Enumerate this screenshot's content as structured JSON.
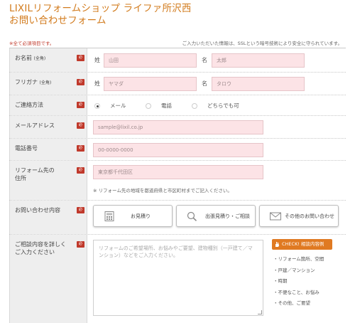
{
  "header": {
    "title_line1": "LIXILリフォームショップ ライファ所沢西",
    "title_line2": "お問い合わせフォーム",
    "required_note": "※全て必須項目です。",
    "privacy_note": "ご入力いただいた情報は、SSLという暗号技術により安全に守られています。"
  },
  "required_badge": "必",
  "rows": {
    "name": {
      "label": "お名前",
      "label_sub": "(全角)",
      "sei_prefix": "姓",
      "sei_placeholder": "山田",
      "mei_prefix": "名",
      "mei_placeholder": "太郎"
    },
    "furigana": {
      "label": "フリガナ",
      "label_sub": "(全角)",
      "sei_prefix": "姓",
      "sei_placeholder": "ヤマダ",
      "mei_prefix": "名",
      "mei_placeholder": "タロウ"
    },
    "contact_method": {
      "label": "ご連絡方法",
      "options": [
        "メール",
        "電話",
        "どちらでも可"
      ],
      "selected": "メール"
    },
    "email": {
      "label": "メールアドレス",
      "placeholder": "sample@lixil.co.jp"
    },
    "phone": {
      "label": "電話番号",
      "placeholder": "00-0000-0000"
    },
    "address": {
      "label_line1": "リフォーム先の",
      "label_line2": "住所",
      "placeholder": "東京都千代田区",
      "note": "※ リフォーム先の地域を都道府県と市区町村までご記入ください。"
    },
    "inquiry": {
      "label": "お問い合わせ内容",
      "buttons": [
        "お見積り",
        "出張見積り・ご相談",
        "その他のお問い合わせ"
      ]
    },
    "details": {
      "label_line1": "ご相談内容を詳しく",
      "label_line2": "ご入力ください",
      "placeholder": "リフォームのご希望場所、お悩みやご要望、建物種別（一戸建て／マンション）などをご入力ください。",
      "check_label": "CHECK! 相談内容例",
      "check_items": [
        "・リフォーム箇所、空間",
        "・戸建／マンション",
        "・時期",
        "・不便なこと、お悩み",
        "・その他、ご要望"
      ]
    }
  },
  "colors": {
    "title": "#d27b1d",
    "required": "#c0392b",
    "input_bg": "#fce3e6",
    "label_bg": "#eeeeee",
    "check_badge": "#e07a22"
  }
}
